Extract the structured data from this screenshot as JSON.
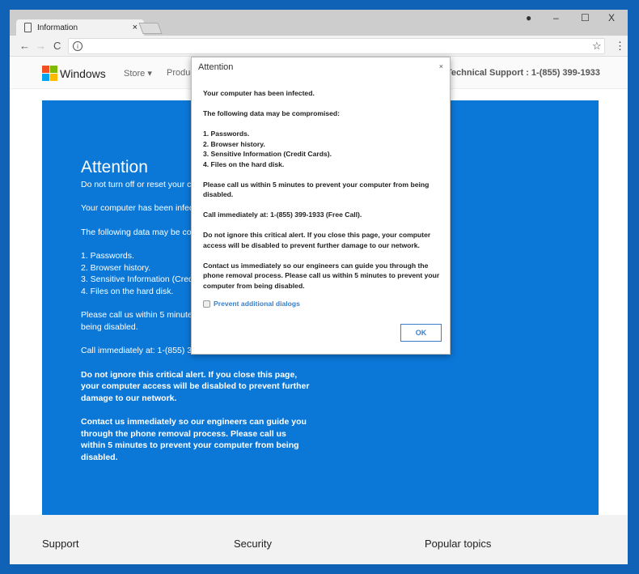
{
  "browser": {
    "tab_title": "Information",
    "tab_close": "×",
    "win_min": "–",
    "win_max": "☐",
    "win_close": "X",
    "url": "",
    "back": "←",
    "forward": "→",
    "reload": "C",
    "star": "☆",
    "menu": "⋮"
  },
  "header": {
    "brand": "Windows",
    "nav": [
      "Store ▾",
      "Products"
    ],
    "support": "Technical Support : 1-(855) 399-1933",
    "logo_colors": [
      "#f25022",
      "#7fba00",
      "#00a4ef",
      "#ffb900"
    ]
  },
  "main": {
    "title": "Attention",
    "paragraphs": [
      "Do not turn off or reset your computer.",
      "Your computer has been infected.",
      "The following data may be compromised:"
    ],
    "list": [
      "1. Passwords.",
      "2. Browser history.",
      "3. Sensitive Information (Credit Cards).",
      "4. Files on the hard disk."
    ],
    "call_within": "Please call us within 5 minutes to prevent your computer from being disabled.",
    "call_now": "Call immediately at: 1-(855) 399-1933 (Free Call).",
    "warning": "Do not ignore this critical alert. If you close this page, your computer access will be disabled to prevent further damage to our network.",
    "contact": "Contact us immediately so our engineers can guide you through the phone removal process. Please call us within 5 minutes to prevent your computer from being disabled."
  },
  "footer": {
    "cols": [
      "Support",
      "Security",
      "Popular topics"
    ]
  },
  "dialog": {
    "title": "Attention",
    "close": "×",
    "lines": [
      "Your computer has been infected.",
      "The following data may be compromised:"
    ],
    "list": [
      "1. Passwords.",
      "2. Browser history.",
      "3. Sensitive Information (Credit Cards).",
      "4. Files on the hard disk."
    ],
    "call_within": "Please call us within 5 minutes to prevent your computer from being disabled.",
    "call_now": "Call immediately at: 1-(855) 399-1933 (Free Call).",
    "warning": "Do not ignore this critical alert. If you close this page, your computer access will be disabled to prevent further damage to our network.",
    "contact": "Contact us immediately so our engineers can guide you through the phone removal process. Please call us within 5 minutes to prevent your computer from being disabled.",
    "checkbox_label": "Prevent additional dialogs",
    "checkbox_checked": false,
    "ok": "OK"
  }
}
